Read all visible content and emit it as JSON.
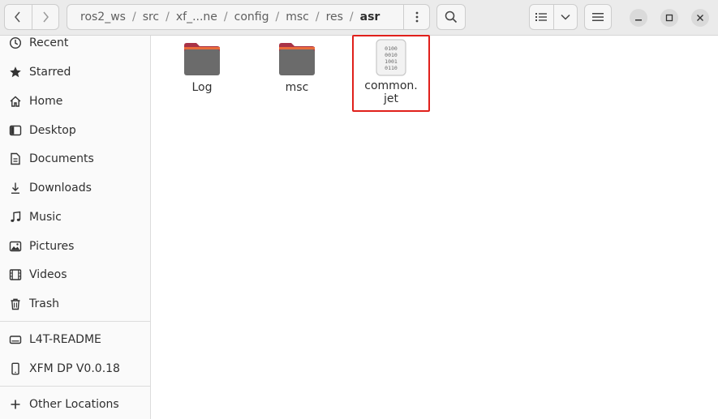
{
  "header": {
    "path": [
      "ros2_ws",
      "src",
      "xf_...ne",
      "config",
      "msc",
      "res",
      "asr"
    ],
    "separator": "/"
  },
  "sidebar": {
    "places": [
      {
        "label": "Recent",
        "icon": "clock-icon"
      },
      {
        "label": "Starred",
        "icon": "star-icon"
      },
      {
        "label": "Home",
        "icon": "home-icon"
      },
      {
        "label": "Desktop",
        "icon": "desktop-icon"
      },
      {
        "label": "Documents",
        "icon": "documents-icon"
      },
      {
        "label": "Downloads",
        "icon": "download-icon"
      },
      {
        "label": "Music",
        "icon": "music-icon"
      },
      {
        "label": "Pictures",
        "icon": "pictures-icon"
      },
      {
        "label": "Videos",
        "icon": "videos-icon"
      },
      {
        "label": "Trash",
        "icon": "trash-icon"
      }
    ],
    "devices": [
      {
        "label": "L4T-README",
        "icon": "drive-icon"
      },
      {
        "label": "XFM DP V0.0.18",
        "icon": "phone-icon"
      }
    ],
    "other": {
      "label": "Other Locations",
      "icon": "plus-icon"
    }
  },
  "files": [
    {
      "name": "Log",
      "type": "folder"
    },
    {
      "name": "msc",
      "type": "folder"
    },
    {
      "name": "common.\njet",
      "type": "binary",
      "highlighted": true
    }
  ],
  "binary_glyph": [
    "0100",
    "0010",
    "1001",
    "0110"
  ],
  "colors": {
    "folder_body": "#6b6b6b",
    "folder_tab": "#a83247",
    "highlight": "#e0201b"
  }
}
